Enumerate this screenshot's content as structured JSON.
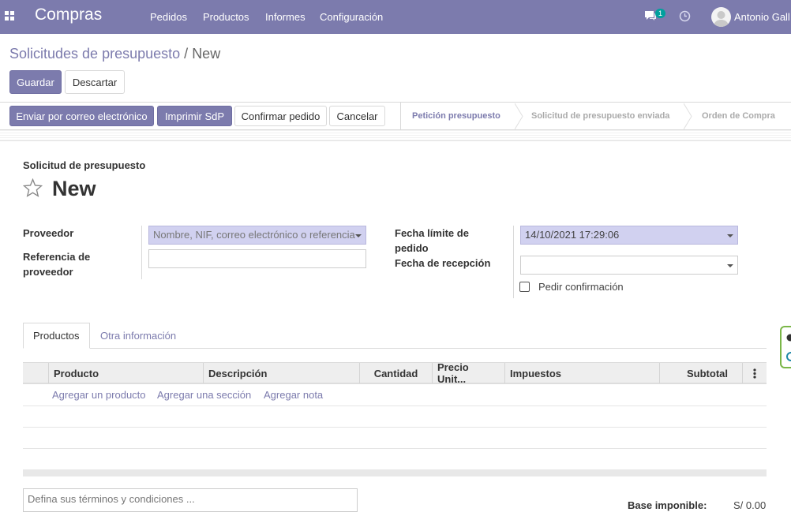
{
  "navbar": {
    "app_name": "Compras",
    "menu": [
      "Pedidos",
      "Productos",
      "Informes",
      "Configuración"
    ],
    "chat_count": "1",
    "user_name": "Antonio Gall"
  },
  "breadcrumb": {
    "parent": "Solicitudes de presupuesto",
    "separator": "/",
    "current": "New"
  },
  "actions": {
    "save": "Guardar",
    "discard": "Descartar"
  },
  "header_buttons": {
    "send_email": "Enviar por correo electrónico",
    "print": "Imprimir SdP",
    "confirm": "Confirmar pedido",
    "cancel": "Cancelar"
  },
  "statusbar": {
    "stages": [
      "Petición presupuesto",
      "Solicitud de presupuesto enviada",
      "Orden de Compra"
    ],
    "active_index": 0
  },
  "form": {
    "document_type": "Solicitud de presupuesto",
    "name": "New",
    "vendor_label": "Proveedor",
    "vendor_placeholder": "Nombre, NIF, correo electrónico o referencia",
    "vendor_ref_label": "Referencia de proveedor",
    "vendor_ref_value": "",
    "order_deadline_label": "Fecha límite de pedido",
    "order_deadline_value": "14/10/2021 17:29:06",
    "receipt_date_label": "Fecha de recepción",
    "receipt_date_value": "",
    "ask_confirmation_label": "Pedir confirmación",
    "ask_confirmation_checked": false
  },
  "tabs": [
    "Productos",
    "Otra información"
  ],
  "table": {
    "columns": [
      "Producto",
      "Descripción",
      "Cantidad",
      "Precio Unit...",
      "Impuestos",
      "Subtotal"
    ],
    "add_links": [
      "Agregar un producto",
      "Agregar una sección",
      "Agregar nota"
    ]
  },
  "footer": {
    "terms_placeholder": "Defina sus términos y condiciones ...",
    "untaxed_label": "Base imponible:",
    "untaxed_value": "S/ 0.00"
  },
  "colors": {
    "brand": "#7c7bad",
    "required_field": "#d1d1f0"
  }
}
